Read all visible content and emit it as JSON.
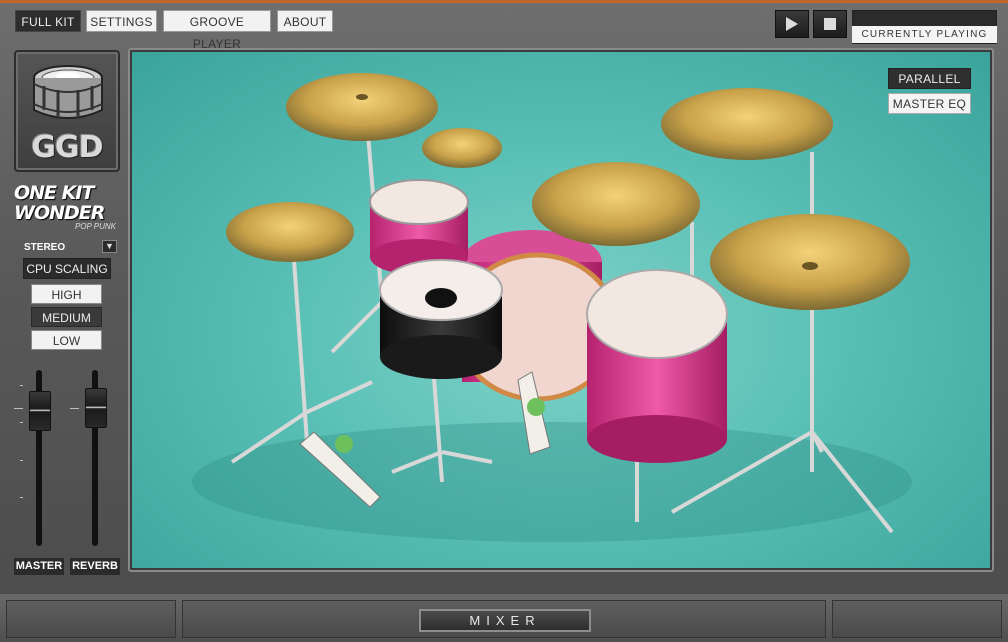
{
  "tabs": [
    {
      "label": "FULL KIT",
      "active": true
    },
    {
      "label": "SETTINGS",
      "active": false
    },
    {
      "label": "GROOVE PLAYER",
      "active": false
    },
    {
      "label": "ABOUT",
      "active": false
    }
  ],
  "transport": {
    "play_icon": "play-icon",
    "stop_icon": "stop-icon",
    "currently_playing_label": "CURRENTLY PLAYING"
  },
  "brand": {
    "logo_text": "GGD",
    "product_name": "ONE KIT WONDER",
    "product_sub": "POP PUNK"
  },
  "output": {
    "stereo_label": "STEREO",
    "stereo_toggle_icon": "dropdown-arrow-icon"
  },
  "cpu": {
    "label": "CPU SCALING",
    "options": [
      "HIGH",
      "MEDIUM",
      "LOW"
    ],
    "selected": "MEDIUM"
  },
  "faders": {
    "master_label": "MASTER",
    "reverb_label": "REVERB"
  },
  "stage_buttons": {
    "parallel_label": "PARALLEL",
    "master_eq_label": "MASTER EQ"
  },
  "bottom": {
    "mixer_label": "MIXER"
  },
  "colors": {
    "accent": "#c0672b",
    "stage_bg": "#5ac0b6",
    "drum_shell": "#e2489a",
    "cymbal": "#c9a24a"
  }
}
